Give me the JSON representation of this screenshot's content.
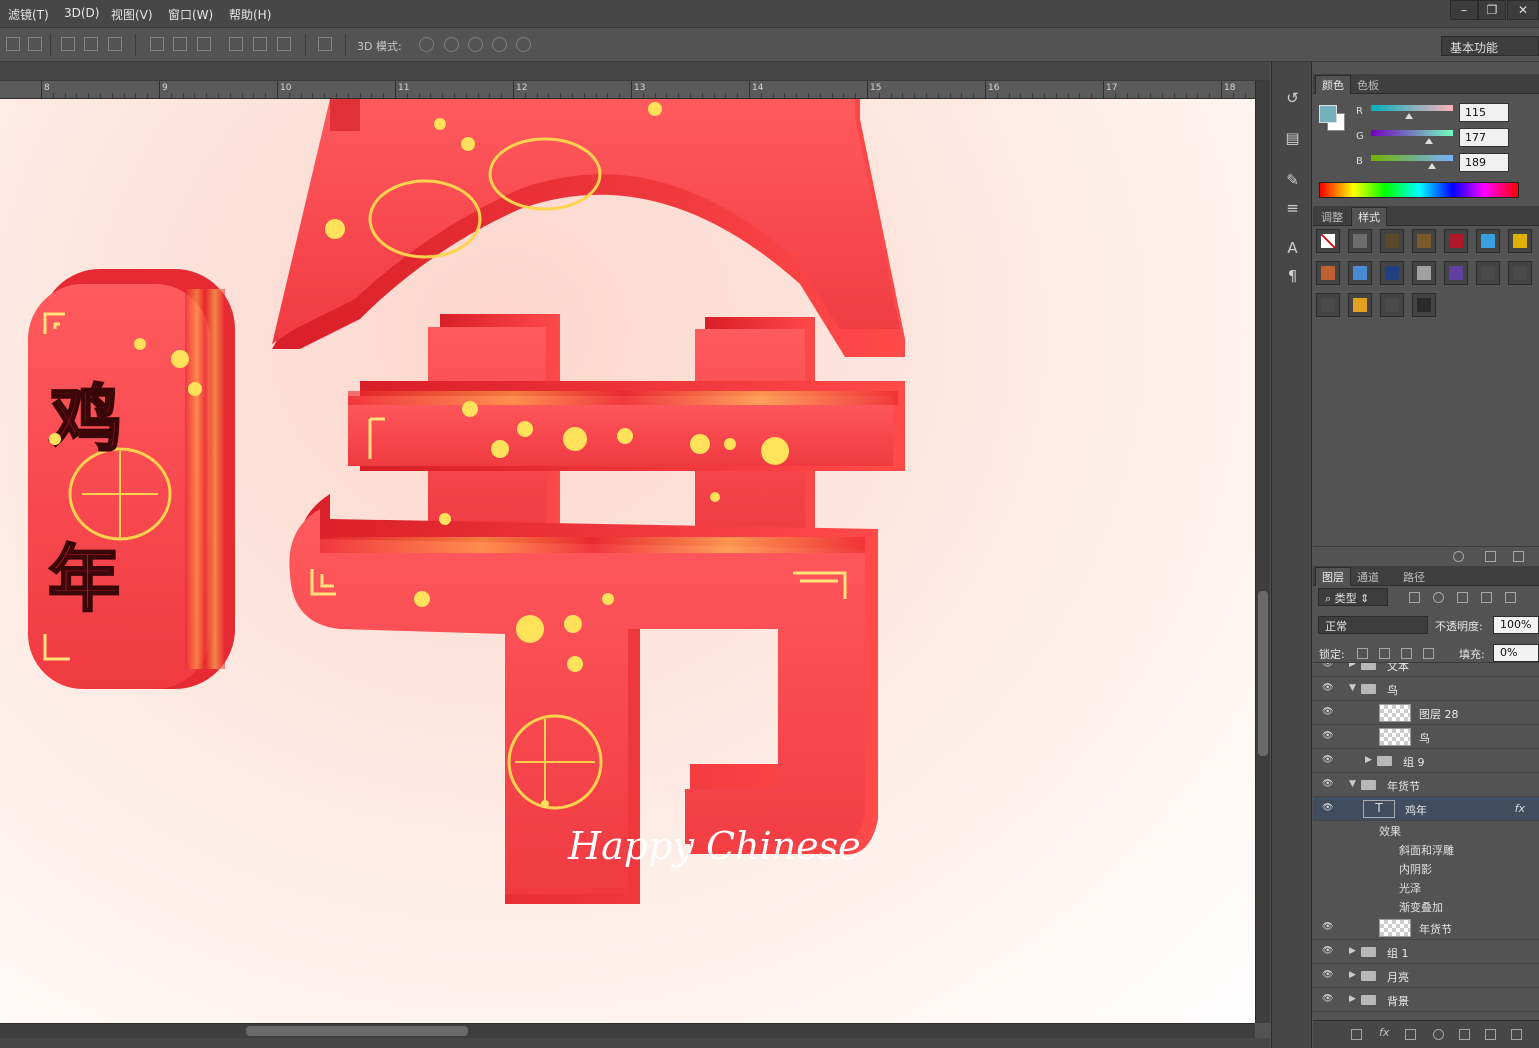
{
  "menu": {
    "items": [
      "滤镜(T)",
      "3D(D)",
      "视图(V)",
      "窗口(W)",
      "帮助(H)"
    ]
  },
  "window_controls": {
    "minimize": "–",
    "restore": "❐",
    "close": "✕"
  },
  "options_bar": {
    "mode3d_label": "3D 模式:",
    "workspace": "基本功能"
  },
  "ruler": {
    "labels": [
      "8",
      "9",
      "10",
      "11",
      "12",
      "13",
      "14",
      "15",
      "16",
      "17",
      "18"
    ]
  },
  "color_panel": {
    "tabs": [
      "颜色",
      "色板"
    ],
    "foreground": "#73b1bd",
    "background": "#ffffff",
    "channels": [
      {
        "label": "R",
        "value": "115"
      },
      {
        "label": "G",
        "value": "177"
      },
      {
        "label": "B",
        "value": "189"
      }
    ]
  },
  "styles_panel": {
    "tabs": [
      "调整",
      "样式"
    ]
  },
  "layers_panel": {
    "tabs": [
      "图层",
      "通道",
      "路径"
    ],
    "filter_kind": "类型",
    "blend_mode": "正常",
    "opacity_label": "不透明度:",
    "opacity_value": "100%",
    "lock_label": "锁定:",
    "fill_label": "填充:",
    "fill_value": "0%",
    "layers": [
      {
        "name": "文本",
        "type": "group",
        "indent": 0,
        "partial": true
      },
      {
        "name": "鸟",
        "type": "group-open",
        "indent": 0
      },
      {
        "name": "图层 28",
        "type": "pixel",
        "indent": 1
      },
      {
        "name": "鸟",
        "type": "pixel",
        "indent": 1
      },
      {
        "name": "组 9",
        "type": "group",
        "indent": 1
      },
      {
        "name": "年货节",
        "type": "group-open",
        "indent": 0
      },
      {
        "name": "鸡年",
        "type": "text",
        "indent": 1,
        "selected": true,
        "fx": "fx"
      },
      {
        "name": "年货节",
        "type": "pixel",
        "indent": 1
      },
      {
        "name": "组 1",
        "type": "group",
        "indent": 0
      },
      {
        "name": "月亮",
        "type": "group",
        "indent": 0
      },
      {
        "name": "背景",
        "type": "group",
        "indent": 0
      }
    ],
    "effects_label": "效果",
    "effects": [
      "斜面和浮雕",
      "内阴影",
      "光泽",
      "渐变叠加"
    ]
  },
  "canvas_text": {
    "badge_top": "鸡",
    "badge_bottom": "年",
    "script": "Happy Chinese"
  }
}
